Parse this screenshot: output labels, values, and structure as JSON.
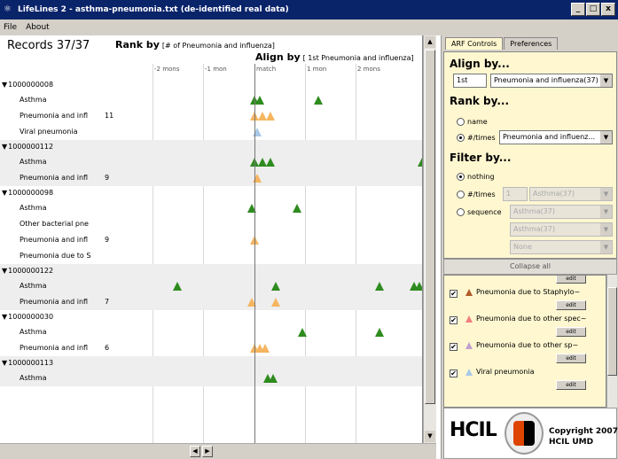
{
  "window": {
    "title": "LifeLines 2 - asthma-pneumonia.txt (de-identified real data)",
    "controls": [
      "_",
      "□",
      "x"
    ]
  },
  "menu": [
    "File",
    "About"
  ],
  "main": {
    "records_label": "Records  37/37",
    "rank_by_label": "Rank by",
    "rank_by_value": "[# of Pneumonia and influenza]",
    "align_by_label": "Align by",
    "align_by_value": "[ 1st Pneumonia and influenza]",
    "ticks": [
      "-2 mons",
      "-1 mon",
      "match",
      "1 mon",
      "2 mons"
    ]
  },
  "records": [
    {
      "id": "1000000008",
      "events": [
        {
          "label": "Asthma",
          "count": "",
          "color": "#2e8b1e",
          "markers": [
            0.0,
            0.02,
            0.24
          ]
        },
        {
          "label": "Pneumonia and infl",
          "count": "11",
          "color": "#f5b560",
          "markers": [
            0.0,
            0.03,
            0.06
          ]
        },
        {
          "label": "Viral pneumonia",
          "count": "",
          "color": "#a8c8e8",
          "markers": [
            0.01
          ]
        }
      ]
    },
    {
      "id": "1000000112",
      "events": [
        {
          "label": "Asthma",
          "count": "",
          "color": "#2e8b1e",
          "markers": [
            0.0,
            0.03,
            0.06,
            0.63
          ]
        },
        {
          "label": "Pneumonia and infl",
          "count": "9",
          "color": "#f5b560",
          "markers": [
            0.01
          ]
        }
      ]
    },
    {
      "id": "1000000098",
      "events": [
        {
          "label": "Asthma",
          "count": "",
          "color": "#2e8b1e",
          "markers": [
            -0.01,
            0.16
          ]
        },
        {
          "label": "Other bacterial pne",
          "count": "",
          "color": "#2e8b1e",
          "markers": []
        },
        {
          "label": "Pneumonia and infl",
          "count": "9",
          "color": "#f5b560",
          "markers": [
            0.0
          ]
        },
        {
          "label": "Pneumonia due to S",
          "count": "",
          "color": "#2e8b1e",
          "markers": []
        }
      ]
    },
    {
      "id": "1000000122",
      "events": [
        {
          "label": "Asthma",
          "count": "",
          "color": "#2e8b1e",
          "markers": [
            -0.29,
            0.08,
            0.47,
            0.6,
            0.62
          ]
        },
        {
          "label": "Pneumonia and infl",
          "count": "7",
          "color": "#f5b560",
          "markers": [
            -0.01,
            0.08
          ]
        }
      ]
    },
    {
      "id": "1000000030",
      "events": [
        {
          "label": "Asthma",
          "count": "",
          "color": "#2e8b1e",
          "markers": [
            0.18,
            0.47
          ]
        },
        {
          "label": "Pneumonia and infl",
          "count": "6",
          "color": "#f5b560",
          "markers": [
            0.0,
            0.02,
            0.04
          ]
        }
      ]
    },
    {
      "id": "1000000113",
      "events": [
        {
          "label": "Asthma",
          "count": "",
          "color": "#2e8b1e",
          "markers": [
            0.05,
            0.07
          ]
        }
      ]
    }
  ],
  "panel": {
    "tabs": [
      "ARF Controls",
      "Preferences"
    ],
    "align_by": {
      "title": "Align by...",
      "ordinal": "1st",
      "event": "Pneumonia and influenza(37)"
    },
    "rank_by": {
      "title": "Rank by...",
      "options": [
        "name",
        "#/times"
      ],
      "selected": "#/times",
      "event": "Pneumonia and influenz..."
    },
    "filter_by": {
      "title": "Filter by...",
      "options": [
        "nothing",
        "#/times",
        "sequence"
      ],
      "selected": "nothing",
      "times_value": "1",
      "times_event": "Asthma(37)",
      "seq_events": [
        "Asthma(37)",
        "Asthma(37)",
        "None"
      ]
    },
    "collapse_label": "Collapse all",
    "legend": [
      {
        "label": "",
        "color": "#2e8b1e",
        "edit": "edit"
      },
      {
        "label": "Pneumonia due to Staphylo~",
        "color": "#b15c2a",
        "edit": "edit"
      },
      {
        "label": "Pneumonia due to other spec~",
        "color": "#f08080",
        "edit": "edit"
      },
      {
        "label": "Pneumonia due to other sp~",
        "color": "#c0a0d0",
        "edit": "edit"
      },
      {
        "label": "Viral pneumonia",
        "color": "#a8c8e8",
        "edit": "edit"
      }
    ],
    "logos": {
      "hcil": "HCIL",
      "copyright_line1": "Copyright 2007",
      "copyright_line2": "HCIL  UMD"
    }
  }
}
